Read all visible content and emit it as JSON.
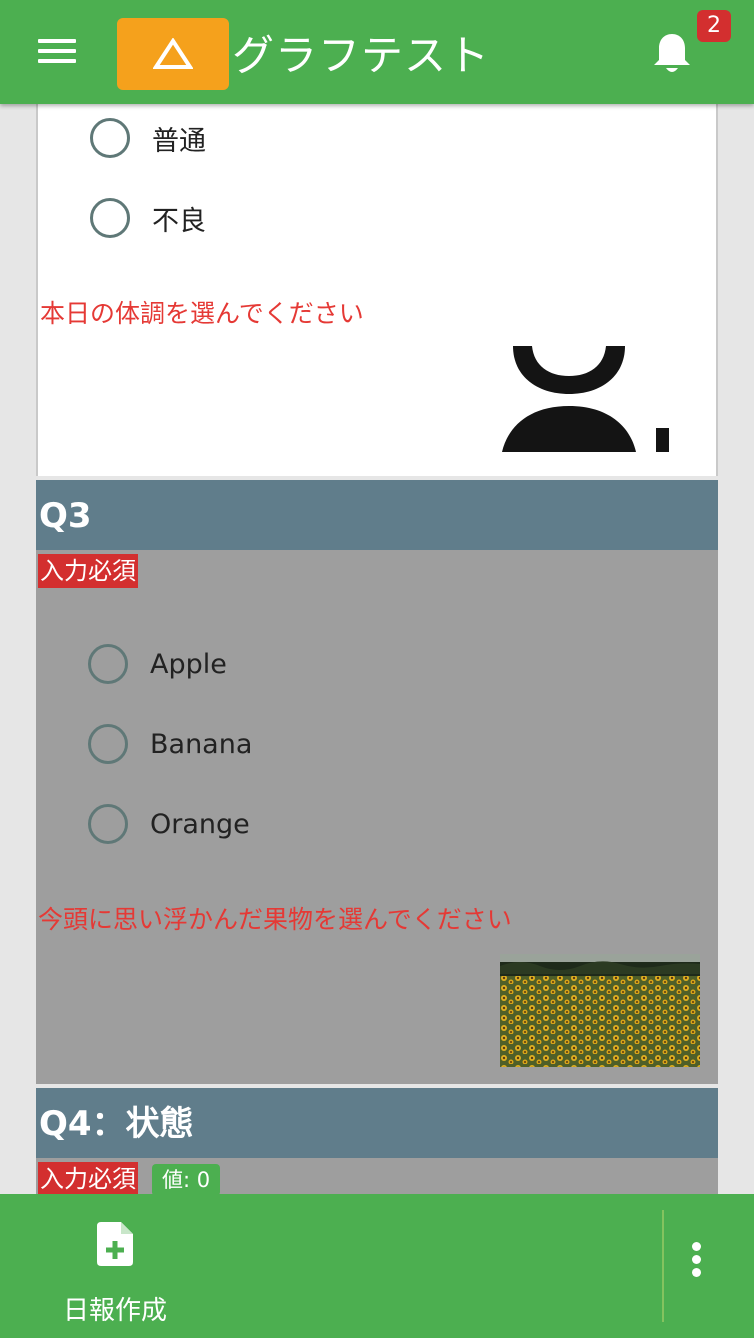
{
  "header": {
    "title": "グラフテスト",
    "notification_count": "2"
  },
  "q2": {
    "options": [
      "普通",
      "不良"
    ],
    "hint": "本日の体調を選んでください"
  },
  "q3": {
    "title": "Q3",
    "required": "入力必須",
    "options": [
      "Apple",
      "Banana",
      "Orange"
    ],
    "hint": "今頭に思い浮かんだ果物を選んでください"
  },
  "q4": {
    "title": "Q4：状態",
    "required": "入力必須",
    "value_label": "値: 0"
  },
  "bottom_bar": {
    "create_report": "日報作成"
  },
  "colors": {
    "app_bar": "#4caf50",
    "logo": "#f5a11c",
    "question_header": "#607d8b",
    "required_badge": "#d32f2f",
    "hint_text": "#e53935"
  },
  "icons": {
    "menu": "hamburger-menu-icon",
    "logo": "triangle-warning-logo",
    "notifications": "bell-icon",
    "q2_image": "person-icon",
    "q3_image": "sunflower-photo",
    "create_report": "file-plus-icon",
    "more": "more-vertical-icon"
  }
}
